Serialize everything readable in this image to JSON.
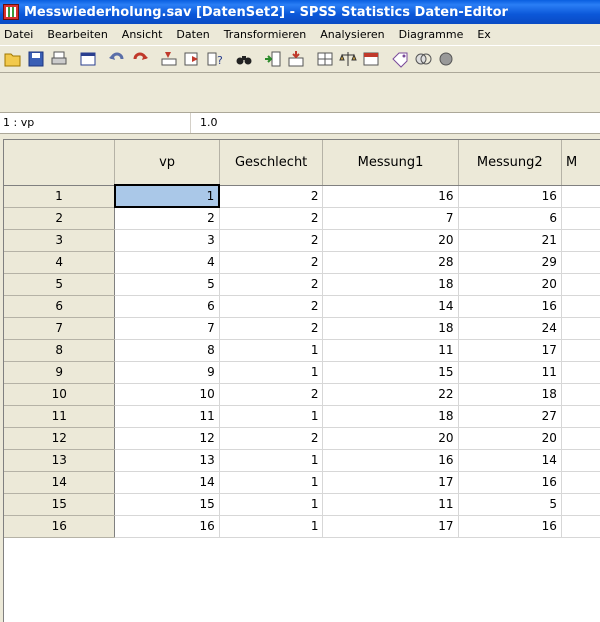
{
  "window": {
    "title": "Messwiederholung.sav [DatenSet2] - SPSS Statistics Daten-Editor"
  },
  "menu": [
    {
      "label": "Datei"
    },
    {
      "label": "Bearbeiten"
    },
    {
      "label": "Ansicht"
    },
    {
      "label": "Daten"
    },
    {
      "label": "Transformieren"
    },
    {
      "label": "Analysieren"
    },
    {
      "label": "Diagramme"
    },
    {
      "label": "Ex"
    }
  ],
  "toolbar": {
    "icons": [
      "open-icon",
      "save-icon",
      "print-icon",
      "dialog-recall-icon",
      "undo-icon",
      "redo-icon",
      "goto-case-icon",
      "goto-variable-icon",
      "variables-icon",
      "find-icon",
      "insert-cases-icon",
      "insert-variable-icon",
      "split-file-icon",
      "weight-cases-icon",
      "select-cases-icon",
      "value-labels-icon",
      "use-sets-icon",
      "show-all-icon"
    ]
  },
  "cell_editor": {
    "reference": "1 : vp",
    "value": "1.0"
  },
  "grid": {
    "columns": [
      "vp",
      "Geschlecht",
      "Messung1",
      "Messung2",
      "M"
    ],
    "rows": [
      {
        "n": "1",
        "cells": [
          "1",
          "2",
          "16",
          "16",
          ""
        ]
      },
      {
        "n": "2",
        "cells": [
          "2",
          "2",
          "7",
          "6",
          ""
        ]
      },
      {
        "n": "3",
        "cells": [
          "3",
          "2",
          "20",
          "21",
          ""
        ]
      },
      {
        "n": "4",
        "cells": [
          "4",
          "2",
          "28",
          "29",
          ""
        ]
      },
      {
        "n": "5",
        "cells": [
          "5",
          "2",
          "18",
          "20",
          ""
        ]
      },
      {
        "n": "6",
        "cells": [
          "6",
          "2",
          "14",
          "16",
          ""
        ]
      },
      {
        "n": "7",
        "cells": [
          "7",
          "2",
          "18",
          "24",
          ""
        ]
      },
      {
        "n": "8",
        "cells": [
          "8",
          "1",
          "11",
          "17",
          ""
        ]
      },
      {
        "n": "9",
        "cells": [
          "9",
          "1",
          "15",
          "11",
          ""
        ]
      },
      {
        "n": "10",
        "cells": [
          "10",
          "2",
          "22",
          "18",
          ""
        ]
      },
      {
        "n": "11",
        "cells": [
          "11",
          "1",
          "18",
          "27",
          ""
        ]
      },
      {
        "n": "12",
        "cells": [
          "12",
          "2",
          "20",
          "20",
          ""
        ]
      },
      {
        "n": "13",
        "cells": [
          "13",
          "1",
          "16",
          "14",
          ""
        ]
      },
      {
        "n": "14",
        "cells": [
          "14",
          "1",
          "17",
          "16",
          ""
        ]
      },
      {
        "n": "15",
        "cells": [
          "15",
          "1",
          "11",
          "5",
          ""
        ]
      },
      {
        "n": "16",
        "cells": [
          "16",
          "1",
          "17",
          "16",
          ""
        ]
      }
    ]
  }
}
